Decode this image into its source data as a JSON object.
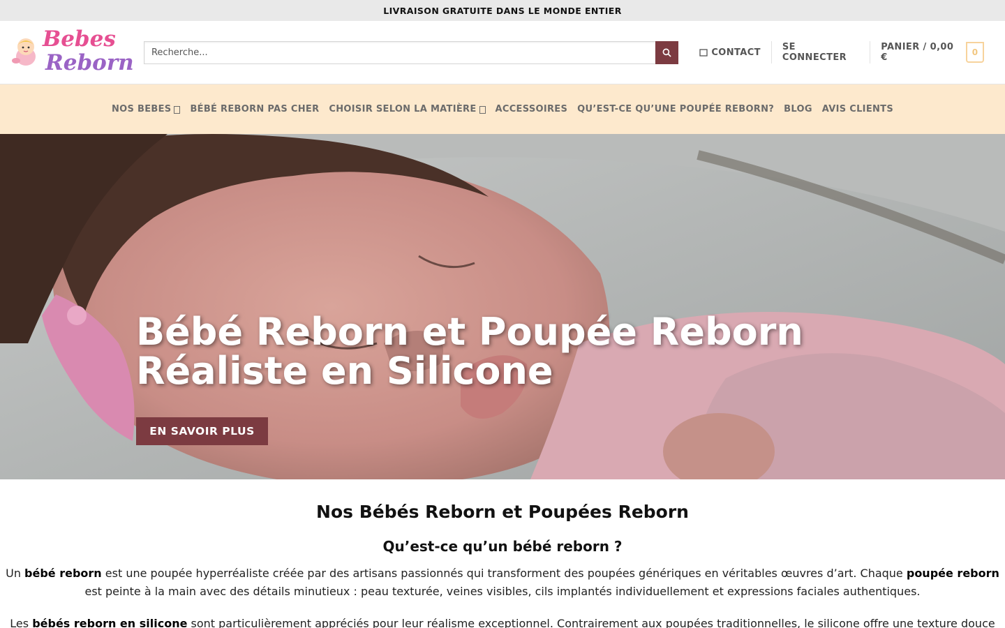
{
  "topbar": {
    "text": "LIVRAISON GRATUITE DANS LE MONDE ENTIER"
  },
  "logo": {
    "line1": "Bebes",
    "line2": "Reborn"
  },
  "search": {
    "placeholder": "Recherche..."
  },
  "header_nav": {
    "contact": "CONTACT",
    "login": "SE CONNECTER",
    "cart": "PANIER / 0,00 €",
    "cart_count": "0"
  },
  "main_nav": {
    "items": [
      "NOS BEBES",
      "BÉBÉ REBORN PAS CHER",
      "CHOISIR SELON LA MATIÈRE",
      "ACCESSOIRES",
      "QU’EST-CE QU’UNE POUPÉE REBORN?",
      "BLOG",
      "AVIS CLIENTS"
    ]
  },
  "hero": {
    "title_line1": "Bébé Reborn et Poupée Reborn",
    "title_line2": "Réaliste en Silicone",
    "button": "EN SAVOIR PLUS"
  },
  "content": {
    "heading": "Nos Bébés Reborn et Poupées Reborn",
    "subheading": "Qu’est-ce qu’un bébé reborn ?",
    "p1": {
      "t1": "Un ",
      "b1": "bébé reborn",
      "t2": " est une poupée hyperréaliste créée par des artisans passionnés qui transforment des poupées génériques en véritables œuvres d’art. Chaque ",
      "b2": "poupée reborn",
      "t3": " est peinte à la main avec des détails minutieux : peau texturée, veines visibles, cils implantés individuellement et expressions faciales authentiques."
    },
    "p2": {
      "t1": "Les ",
      "b1": "bébés reborn en silicone",
      "t2": " sont particulièrement appréciés pour leur réalisme exceptionnel. Contrairement aux poupées traditionnelles, le silicone offre une texture douce et"
    }
  },
  "colors": {
    "accent": "#7c3b41",
    "nav_bg": "#fde9cd",
    "topbar_bg": "#e9e9e9"
  }
}
